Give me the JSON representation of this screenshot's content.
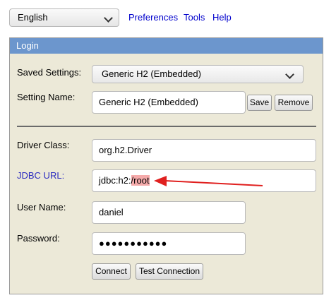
{
  "top": {
    "language": "English",
    "links": [
      "Preferences",
      "Tools",
      "Help"
    ]
  },
  "login": {
    "title": "Login",
    "saved_settings_label": "Saved Settings:",
    "saved_settings_value": "Generic H2 (Embedded)",
    "setting_name_label": "Setting Name:",
    "setting_name_value": "Generic H2 (Embedded)",
    "save_label": "Save",
    "remove_label": "Remove",
    "driver_class_label": "Driver Class:",
    "driver_class_value": "org.h2.Driver",
    "jdbc_url_label": "JDBC URL:",
    "jdbc_url_prefix": "jdbc:h2:",
    "jdbc_url_highlight": "/root",
    "user_name_label": "User Name:",
    "user_name_value": "daniel",
    "password_label": "Password:",
    "password_value": "●●●●●●●●●●●",
    "connect_label": "Connect",
    "test_connection_label": "Test Connection"
  },
  "colors": {
    "header": "#6c96cd",
    "panel": "#ece9d8",
    "link": "#0000cc",
    "highlight": "#f5aaaa",
    "annotation_arrow": "#e0201f"
  },
  "annotation": {
    "icon": "red-arrow-icon"
  }
}
